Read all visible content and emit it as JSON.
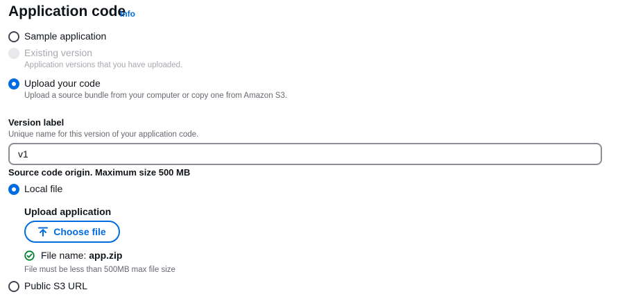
{
  "section": {
    "title": "Application code",
    "info_link": "Info"
  },
  "code_options": [
    {
      "label": "Sample application",
      "description": "",
      "state": "unchecked"
    },
    {
      "label": "Existing version",
      "description": "Application versions that you have uploaded.",
      "state": "disabled"
    },
    {
      "label": "Upload your code",
      "description": "Upload a source bundle from your computer or copy one from Amazon S3.",
      "state": "checked"
    }
  ],
  "version": {
    "label": "Version label",
    "hint": "Unique name for this version of your application code.",
    "value": "v1"
  },
  "source": {
    "label": "Source code origin. Maximum size 500 MB",
    "local_file_label": "Local file",
    "public_s3_label": "Public S3 URL"
  },
  "upload": {
    "label": "Upload application",
    "button": "Choose file",
    "file_name_prefix": "File name:",
    "file_name": "app.zip",
    "constraint": "File must be less than 500MB max file size"
  },
  "colors": {
    "accent": "#006ce0",
    "success": "#00802f",
    "text": "#0f141a",
    "muted": "#656871",
    "disabled": "#a5a9af"
  }
}
